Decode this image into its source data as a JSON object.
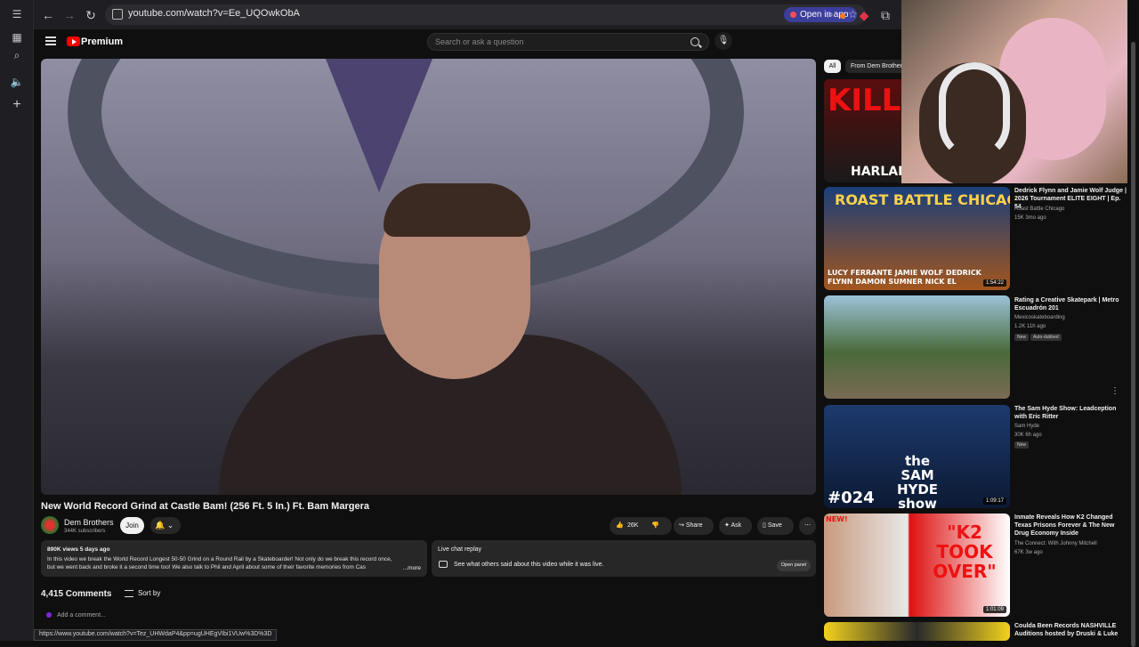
{
  "browser": {
    "url": "youtube.com/watch?v=Ee_UQOwkObA",
    "open_in_app": "Open in app",
    "status_url": "https://www.youtube.com/watch?v=Tez_UHWdaP4&pp=ugUHEgVIbi1VUw%3D%3D"
  },
  "header": {
    "logo_text": "Premium",
    "search_placeholder": "Search or ask a question"
  },
  "video": {
    "title": "New World Record Grind at Castle Bam! (256 Ft. 5 In.) Ft. Bam Margera",
    "channel": "Dem Brothers",
    "subscribers": "344K subscribers",
    "join": "Join",
    "likes": "26K",
    "share": "Share",
    "ask": "Ask",
    "save": "Save",
    "views_date": "890K views  5 days ago",
    "description": "In this video we break the World Record Longest 50-50 Grind on a Round Rail by a Skateboarder! Not only do we break this record once, but we went back and broke it a second time too! We also talk to Phil and April about some of their favorite memories from Cas",
    "more": "...more",
    "chat_title": "Live chat replay",
    "chat_sub": "See what others said about this video while it was live.",
    "chat_open": "Open panel",
    "comments_count": "4,415 Comments",
    "sort_by": "Sort by",
    "add_comment": "Add a comment..."
  },
  "chips": {
    "all": "All",
    "from": "From Dem Brothers"
  },
  "recommendations": [
    {
      "thumb_text": "KILL",
      "thumb_sub": "HARLAN",
      "title": "",
      "channel": "",
      "stats": ""
    },
    {
      "thumb_text": "ROAST BATTLE CHICAGO",
      "thumb_sub": "LUCY FERRANTE  JAMIE WOLF  DEDRICK FLYNN  DAMON SUMNER  NICK EL",
      "duration": "1:54:22",
      "title": "Dedrick Flynn and Jamie Wolf Judge | 2026 Tournament ELITE EIGHT | Ep. 54",
      "channel": "Roast Battle Chicago",
      "stats": "15K  3mo ago"
    },
    {
      "title": "Rating a Creative Skatepark | Metro Escuadrón 201",
      "channel": "Mexicoskateboarding",
      "stats": "1.2K  11h ago",
      "badge1": "New",
      "badge2": "Auto-dubbed"
    },
    {
      "thumb_text": "#024",
      "thumb_sub": "the SAM HYDE show",
      "duration": "1:09:17",
      "title": "The Sam Hyde Show: Leadception with Eric Ritter",
      "channel": "Sam Hyde",
      "stats": "30K  6h ago",
      "badge1": "New"
    },
    {
      "thumb_text": "\"K2 TOOK OVER\"",
      "thumb_sub": "NEW!",
      "duration": "1:01:09",
      "title": "Inmate Reveals How K2 Changed Texas Prisons Forever & The New Drug Economy Inside",
      "channel": "The Connect: With Johnny Mitchell",
      "stats": "67K  3w ago"
    },
    {
      "title": "Coulda Been Records NASHVILLE Auditions hosted by Druski & Luke",
      "channel": "",
      "stats": ""
    }
  ],
  "colors": {
    "background": "#0f0f0f",
    "accent": "#ff0000",
    "open_app": "#3b3e9a"
  }
}
